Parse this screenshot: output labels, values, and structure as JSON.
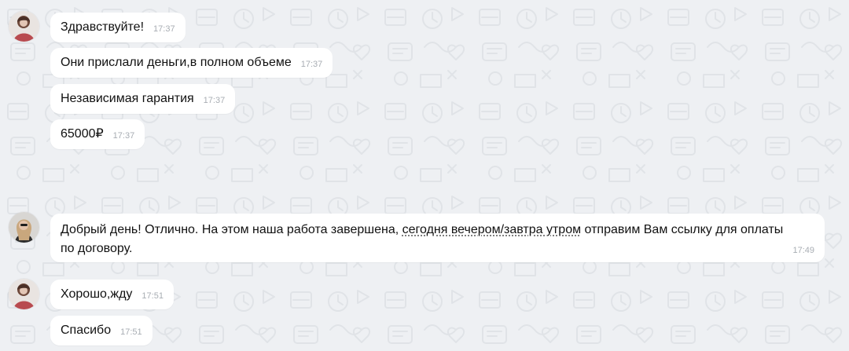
{
  "chat": {
    "messages": [
      {
        "text": "Здравствуйте!",
        "time": "17:37"
      },
      {
        "text": "Они прислали деньги,в полном объеме",
        "time": "17:37"
      },
      {
        "text": "Независимая гарантия",
        "time": "17:37"
      },
      {
        "text": "65000₽",
        "time": "17:37"
      },
      {
        "text_before": "Добрый день! Отлично. На этом наша работа завершена, ",
        "text_underlined": "сегодня вечером/завтра утром",
        "text_after": " отправим Вам ссылку для оплаты по договору.",
        "time": "17:49"
      },
      {
        "text": "Хорошо,жду",
        "time": "17:51"
      },
      {
        "text": "Спасибо",
        "time": "17:51"
      }
    ]
  },
  "colors": {
    "background": "#eef0f3",
    "bubble": "#ffffff",
    "timestamp": "#a8adb3",
    "text": "#111111"
  },
  "icons": {
    "background_pattern": "doodle-pattern",
    "avatar_1": "user-avatar-photo",
    "avatar_2": "user-avatar-photo"
  }
}
